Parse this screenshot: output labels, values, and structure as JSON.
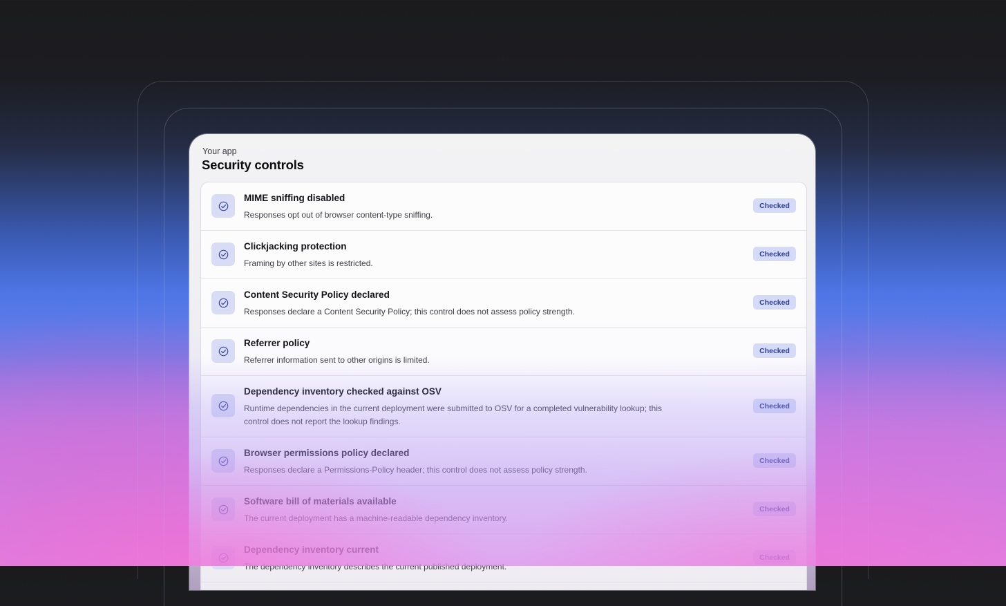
{
  "header": {
    "eyebrow": "Your app",
    "title": "Security controls"
  },
  "controls": [
    {
      "title": "MIME sniffing disabled",
      "description": "Responses opt out of browser content-type sniffing.",
      "status": "Checked"
    },
    {
      "title": "Clickjacking protection",
      "description": "Framing by other sites is restricted.",
      "status": "Checked"
    },
    {
      "title": "Content Security Policy declared",
      "description": "Responses declare a Content Security Policy; this control does not assess policy strength.",
      "status": "Checked"
    },
    {
      "title": "Referrer policy",
      "description": "Referrer information sent to other origins is limited.",
      "status": "Checked"
    },
    {
      "title": "Dependency inventory checked against OSV",
      "description": "Runtime dependencies in the current deployment were submitted to OSV for a completed vulnerability lookup; this control does not report the lookup findings.",
      "status": "Checked"
    },
    {
      "title": "Browser permissions policy declared",
      "description": "Responses declare a Permissions-Policy header; this control does not assess policy strength.",
      "status": "Checked"
    },
    {
      "title": "Software bill of materials available",
      "description": "The current deployment has a machine-readable dependency inventory.",
      "status": "Checked"
    },
    {
      "title": "Dependency inventory current",
      "description": "The dependency inventory describes the current published deployment.",
      "status": "Checked"
    }
  ],
  "icons": {
    "status": "check-circle-icon"
  },
  "colors": {
    "badge_bg": "#d5dbf6",
    "badge_text": "#2d3e9a",
    "icon_bg": "#d8dcf4",
    "icon_stroke": "#3544a0"
  }
}
